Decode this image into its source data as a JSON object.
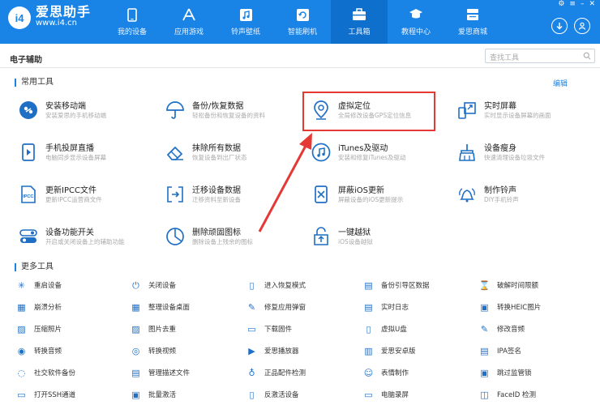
{
  "header": {
    "logo_mark": "i4",
    "logo_cn": "爱思助手",
    "logo_url": "www.i4.cn",
    "nav": [
      {
        "label": "我的设备",
        "icon": "phone-icon"
      },
      {
        "label": "应用游戏",
        "icon": "app-store-icon"
      },
      {
        "label": "铃声壁纸",
        "icon": "music-icon"
      },
      {
        "label": "智能刷机",
        "icon": "refresh-box-icon"
      },
      {
        "label": "工具箱",
        "icon": "toolbox-icon"
      },
      {
        "label": "教程中心",
        "icon": "graduation-cap-icon"
      },
      {
        "label": "爱思商城",
        "icon": "shop-icon"
      }
    ],
    "active_nav": "工具箱",
    "window_controls": [
      "⚙",
      "≡",
      "–",
      "✕"
    ]
  },
  "subbar": {
    "title": "电子辅助",
    "search_placeholder": "查找工具"
  },
  "common": {
    "title": "常用工具",
    "edit_label": "编辑",
    "tools": [
      {
        "title": "安装移动端",
        "desc": "安装爱思的手机移动端",
        "icon": "install-mobile-icon"
      },
      {
        "title": "备份/恢复数据",
        "desc": "轻松备份和恢复设备的资料",
        "icon": "umbrella-icon"
      },
      {
        "title": "虚拟定位",
        "desc": "全局修改设备GPS定位信息",
        "icon": "location-pin-icon"
      },
      {
        "title": "实时屏幕",
        "desc": "实时显示设备屏幕的画面",
        "icon": "screen-mirror-icon"
      },
      {
        "title": "手机投屏直播",
        "desc": "电脑同步显示设备屏幕",
        "icon": "phone-cast-icon"
      },
      {
        "title": "抹除所有数据",
        "desc": "恢复设备到出厂状态",
        "icon": "eraser-icon"
      },
      {
        "title": "iTunes及驱动",
        "desc": "安装和修复iTunes及驱动",
        "icon": "itunes-icon"
      },
      {
        "title": "设备瘦身",
        "desc": "快速清理设备垃圾文件",
        "icon": "broom-icon"
      },
      {
        "title": "更新IPCC文件",
        "desc": "更新IPCC运营商文件",
        "icon": "ipcc-file-icon"
      },
      {
        "title": "迁移设备数据",
        "desc": "迁移资料至新设备",
        "icon": "migrate-icon"
      },
      {
        "title": "屏蔽iOS更新",
        "desc": "屏蔽设备的iOS更新提示",
        "icon": "block-update-icon"
      },
      {
        "title": "制作铃声",
        "desc": "DIY手机铃声",
        "icon": "bell-icon"
      },
      {
        "title": "设备功能开关",
        "desc": "开启或关闭设备上的辅助功能",
        "icon": "toggle-icon"
      },
      {
        "title": "删除顽固图标",
        "desc": "删除设备上残余的图标",
        "icon": "pie-icon"
      },
      {
        "title": "一键越狱",
        "desc": "iOS设备越狱",
        "icon": "jailbreak-icon"
      }
    ]
  },
  "more": {
    "title": "更多工具",
    "tools": [
      {
        "label": "重启设备",
        "icon": "restart-icon"
      },
      {
        "label": "关闭设备",
        "icon": "power-icon"
      },
      {
        "label": "进入恢复模式",
        "icon": "recovery-mode-icon"
      },
      {
        "label": "备份引导区数据",
        "icon": "backup-boot-icon"
      },
      {
        "label": "破解时间限额",
        "icon": "hourglass-icon"
      },
      {
        "label": "崩溃分析",
        "icon": "crash-analysis-icon"
      },
      {
        "label": "整理设备桌面",
        "icon": "desktop-grid-icon"
      },
      {
        "label": "修复应用弹窗",
        "icon": "fix-popup-icon"
      },
      {
        "label": "实时日志",
        "icon": "log-icon"
      },
      {
        "label": "转换HEIC图片",
        "icon": "heic-convert-icon"
      },
      {
        "label": "压缩照片",
        "icon": "compress-photo-icon"
      },
      {
        "label": "图片去重",
        "icon": "dedupe-image-icon"
      },
      {
        "label": "下载固件",
        "icon": "download-firmware-icon"
      },
      {
        "label": "虚拟U盘",
        "icon": "usb-drive-icon"
      },
      {
        "label": "修改音频",
        "icon": "edit-audio-icon"
      },
      {
        "label": "转换音频",
        "icon": "convert-audio-icon"
      },
      {
        "label": "转换视频",
        "icon": "convert-video-icon"
      },
      {
        "label": "爱思播放器",
        "icon": "player-icon"
      },
      {
        "label": "爱思安卓版",
        "icon": "android-icon"
      },
      {
        "label": "IPA签名",
        "icon": "ipa-sign-icon"
      },
      {
        "label": "社交软件备份",
        "icon": "social-backup-icon"
      },
      {
        "label": "管理描述文件",
        "icon": "profile-icon"
      },
      {
        "label": "正品配件检测",
        "icon": "accessory-check-icon"
      },
      {
        "label": "表情制作",
        "icon": "emoji-icon"
      },
      {
        "label": "跳过监管锁",
        "icon": "skip-lock-icon"
      },
      {
        "label": "打开SSH通道",
        "icon": "ssh-icon"
      },
      {
        "label": "批量激活",
        "icon": "batch-activate-icon"
      },
      {
        "label": "反激活设备",
        "icon": "deactivate-icon"
      },
      {
        "label": "电脑录屏",
        "icon": "screen-record-icon"
      },
      {
        "label": "FaceID 检测",
        "icon": "faceid-icon"
      }
    ]
  },
  "colors": {
    "brand": "#1a84e6",
    "highlight": "#e53935",
    "icon": "#1f6fc4"
  }
}
